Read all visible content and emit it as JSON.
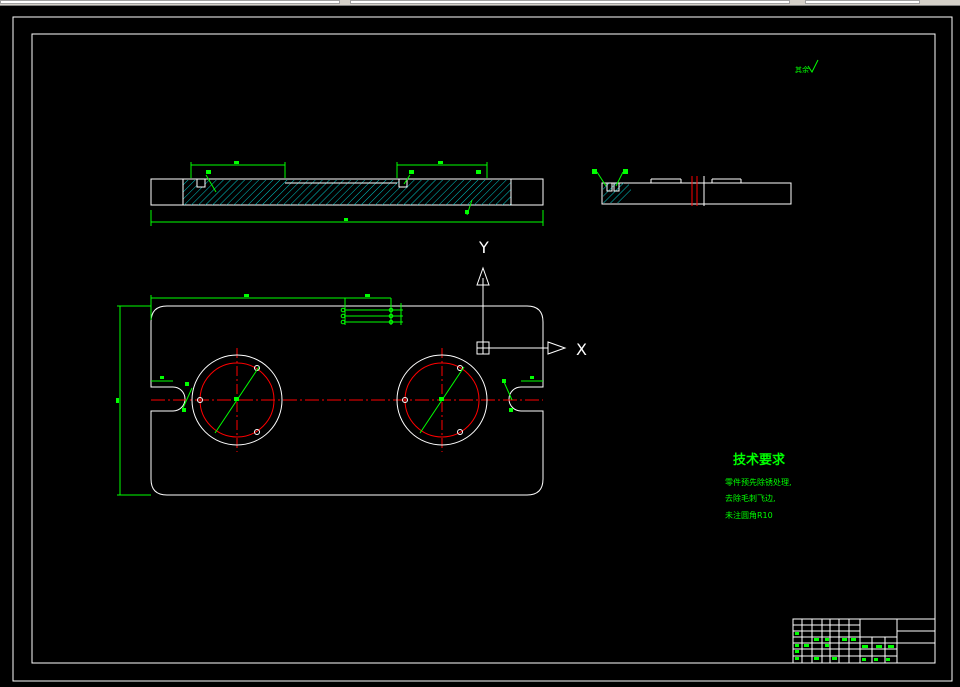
{
  "drawing": {
    "roughness_symbol": "其余",
    "notes_title": "技术要求",
    "notes": [
      "零件预先除锈处理,",
      "去除毛刺飞边,",
      "未注圆角R10"
    ]
  },
  "ucs": {
    "y_label": "Y",
    "x_label": "X"
  },
  "colors": {
    "background": "#000000",
    "outline": "#ffffff",
    "dimension": "#00ff00",
    "centerline": "#ff0000",
    "hatch": "#00c8c8"
  }
}
